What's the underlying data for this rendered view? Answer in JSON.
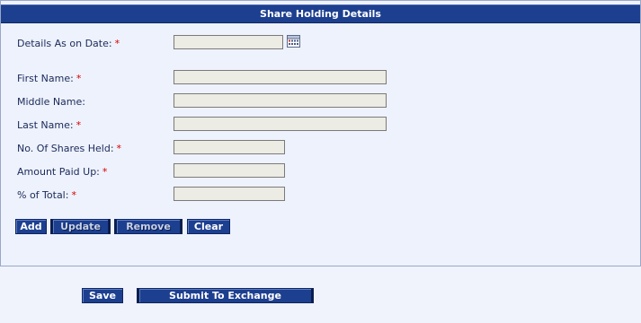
{
  "header": {
    "title": "Share Holding Details"
  },
  "form": {
    "details_date": {
      "label": "Details As on Date:",
      "required_mark": "*",
      "value": ""
    },
    "first_name": {
      "label": "First Name:",
      "required_mark": "*",
      "value": ""
    },
    "middle_name": {
      "label": "Middle Name:",
      "value": ""
    },
    "last_name": {
      "label": "Last Name:",
      "required_mark": "*",
      "value": ""
    },
    "shares_held": {
      "label": "No. Of Shares Held:",
      "required_mark": "*",
      "value": ""
    },
    "amount_paid": {
      "label": "Amount Paid Up:",
      "required_mark": "*",
      "value": ""
    },
    "percent_total": {
      "label": "% of Total:",
      "required_mark": "*",
      "value": ""
    }
  },
  "row_buttons": {
    "add": "Add",
    "update": "Update",
    "remove": "Remove",
    "clear": "Clear"
  },
  "footer_buttons": {
    "save": "Save",
    "submit": "Submit To Exchange"
  },
  "icons": {
    "date_picker": "calendar-icon"
  },
  "colors": {
    "header_bg": "#1d3f8f",
    "button_bg": "#1d3f8f",
    "required": "#d40000",
    "field_bg": "#ecebe4",
    "panel_bg": "#eef2fc"
  }
}
